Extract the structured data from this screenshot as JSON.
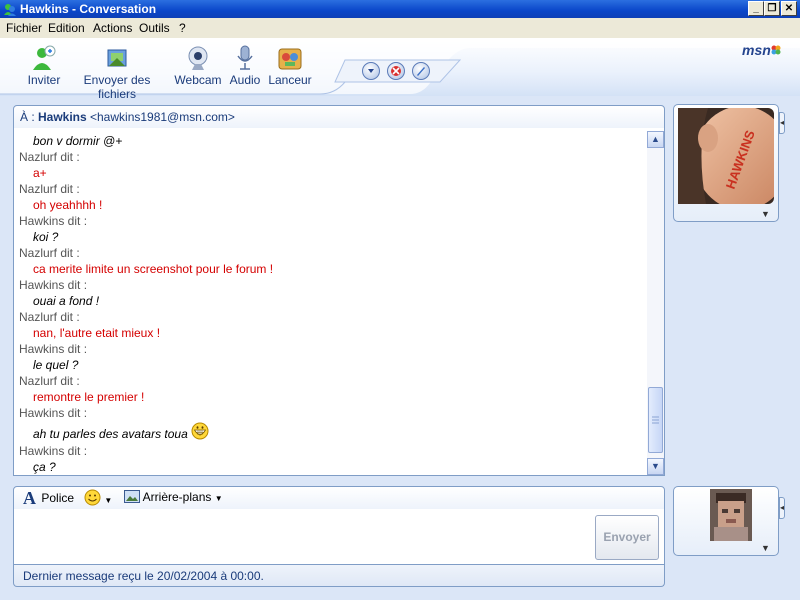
{
  "window": {
    "title": "Hawkins - Conversation",
    "controls": [
      "minimize",
      "restore",
      "close"
    ]
  },
  "menu": {
    "items": [
      "Fichier",
      "Edition",
      "Actions",
      "Outils",
      "?"
    ]
  },
  "toolbar": {
    "buttons": [
      {
        "label": "Inviter",
        "icon": "invite-icon"
      },
      {
        "label": "Envoyer des fichiers",
        "icon": "send-files-icon"
      },
      {
        "label": "Webcam",
        "icon": "webcam-icon"
      },
      {
        "label": "Audio",
        "icon": "microphone-icon"
      },
      {
        "label": "Lanceur",
        "icon": "launcher-icon"
      }
    ],
    "small_buttons": [
      "more-options-icon",
      "block-icon",
      "background-icon"
    ],
    "brand": "msn"
  },
  "conversation": {
    "to_label": "À :",
    "contact_name": "Hawkins",
    "contact_email": "<hawkins1981@msn.com>",
    "messages": [
      {
        "speaker": "",
        "text": "bon v dormir @+",
        "kind": "h"
      },
      {
        "speaker": "Nazlurf dit :",
        "text": "a+",
        "kind": "n"
      },
      {
        "speaker": "Nazlurf dit :",
        "text": "oh yeahhhh !",
        "kind": "n"
      },
      {
        "speaker": "Hawkins dit :",
        "text": "koi ?",
        "kind": "h"
      },
      {
        "speaker": "Nazlurf dit :",
        "text": "ca merite limite un screenshot pour le forum !",
        "kind": "n"
      },
      {
        "speaker": "Hawkins dit :",
        "text": "ouai a fond !",
        "kind": "h"
      },
      {
        "speaker": "Nazlurf dit :",
        "text": "nan, l'autre etait mieux !",
        "kind": "n"
      },
      {
        "speaker": "Hawkins dit :",
        "text": "le quel ?",
        "kind": "h"
      },
      {
        "speaker": "Nazlurf dit :",
        "text": "remontre le premier !",
        "kind": "n"
      },
      {
        "speaker": "Hawkins dit :",
        "text": "ah tu parles des avatars toua",
        "kind": "h",
        "emoticon": "grin-smiley-icon"
      },
      {
        "speaker": "Hawkins dit :",
        "text": "ça ?",
        "kind": "h"
      }
    ]
  },
  "compose": {
    "font_label": "Police",
    "emoticon_icon": "smiley-icon",
    "background_label": "Arrière-plans",
    "input_value": "",
    "send_label": "Envoyer"
  },
  "status": {
    "text": "Dernier message reçu le 20/02/2004 à 00:00."
  },
  "display_pictures": {
    "contact_avatar_text": "HAWKINS"
  },
  "colors": {
    "title_blue": "#0a46c9",
    "contact_text": "#000000",
    "self_text": "#d40000",
    "accent": "#1a3b7a"
  }
}
